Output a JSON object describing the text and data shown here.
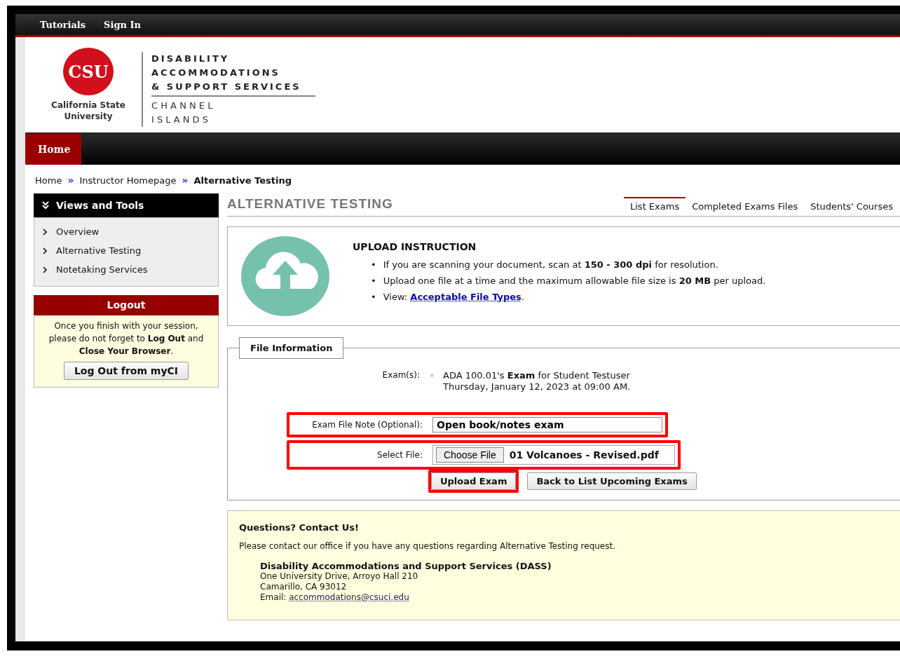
{
  "top_bar": {
    "links": [
      "Tutorials",
      "Sign In"
    ]
  },
  "header": {
    "logo_mark": "CSU",
    "logo_caption": [
      "California State",
      "University"
    ],
    "title_lines": [
      "DISABILITY",
      "ACCOMMODATIONS",
      "& SUPPORT SERVICES"
    ],
    "campus_lines": [
      "C H A N N E L",
      "I S L A N D S"
    ]
  },
  "nav": [
    {
      "label": "Home",
      "selected": true
    }
  ],
  "breadcrumb": {
    "separator": "»",
    "items": [
      "Home",
      "Instructor Homepage",
      "Alternative Testing"
    ]
  },
  "sidebar": {
    "title": "Views and Tools",
    "items": [
      "Overview",
      "Alternative Testing",
      "Notetaking Services"
    ]
  },
  "logout": {
    "title": "Logout",
    "message": "Once you finish with your session, please do not forget to **Log Out** and **Close Your Browser**.",
    "button": "Log Out from myCI"
  },
  "page": {
    "title": "ALTERNATIVE TESTING",
    "tabs": [
      {
        "label": "List Exams",
        "selected": true
      },
      {
        "label": "Completed Exams Files",
        "selected": false
      },
      {
        "label": "Students' Courses",
        "selected": false
      }
    ]
  },
  "upload_instruction": {
    "title": "UPLOAD INSTRUCTION",
    "marker": "•",
    "bullets": [
      "If you are scanning your document, scan at **150 - 300 dpi** for resolution.",
      "Upload one file at a time and the maximum allowable file size is **20 MB** per upload."
    ],
    "view": {
      "prefix": "View:",
      "link": "Acceptable File Types",
      "suffix": "."
    }
  },
  "file_info": {
    "legend": "File Information",
    "exams_label": "Exam(s):",
    "exam_marker": "◦",
    "exams": [
      {
        "line1": "ADA 100.01's **Exam** for Student Testuser",
        "line2": "Thursday, January 12, 2023 at 09:00 AM."
      }
    ],
    "note": {
      "label": "Exam File Note (Optional):",
      "value": "Open book/notes exam",
      "highlighted": true
    },
    "file": {
      "label": "Select File:",
      "button": "Choose File",
      "filename": "01 Volcanoes - Revised.pdf",
      "highlighted": true
    },
    "buttons": [
      {
        "label": "Upload Exam",
        "highlighted": true
      },
      {
        "label": "Back to List Upcoming Exams",
        "highlighted": false
      }
    ]
  },
  "contact": {
    "title": "Questions? Contact Us!",
    "text": "Please contact our office if you have any questions regarding Alternative Testing request.",
    "org": "Disability Accommodations and Support Services (DASS)",
    "address": [
      "One University Drive, Arroyo Hall 210",
      "Camarillo, CA 93012"
    ],
    "email_label": "Email:",
    "email": "accommodations@csuci.edu"
  }
}
